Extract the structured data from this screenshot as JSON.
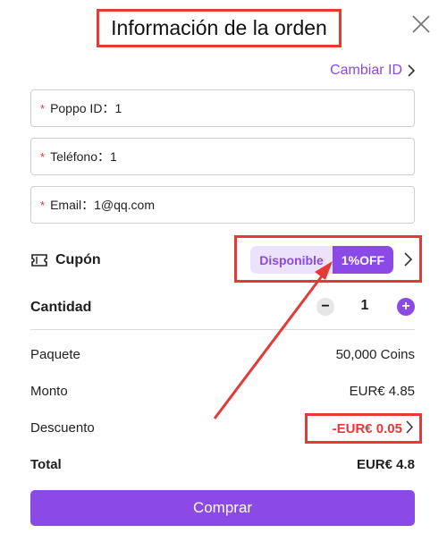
{
  "header": {
    "title": "Información de la orden"
  },
  "change_id": {
    "label": "Cambiar ID"
  },
  "fields": [
    {
      "label": "Poppo ID：",
      "value": "1"
    },
    {
      "label": "Teléfono：",
      "value": "1"
    },
    {
      "label": "Email：",
      "value": "1@qq.com"
    }
  ],
  "coupon": {
    "label": "Cupón",
    "available": "Disponible",
    "discount_badge": "1%OFF"
  },
  "quantity": {
    "label": "Cantidad",
    "value": "1",
    "minus": "−",
    "plus": "+"
  },
  "summary": {
    "package_label": "Paquete",
    "package_value": "50,000 Coins",
    "amount_label": "Monto",
    "amount_value": "EUR€ 4.85",
    "discount_label": "Descuento",
    "discount_value": "-EUR€ 0.05",
    "total_label": "Total",
    "total_value": "EUR€ 4.8"
  },
  "buy_button": {
    "label": "Comprar"
  },
  "colors": {
    "accent": "#8b49e6",
    "annotation_red": "#e53935",
    "discount_red": "#e53935"
  }
}
